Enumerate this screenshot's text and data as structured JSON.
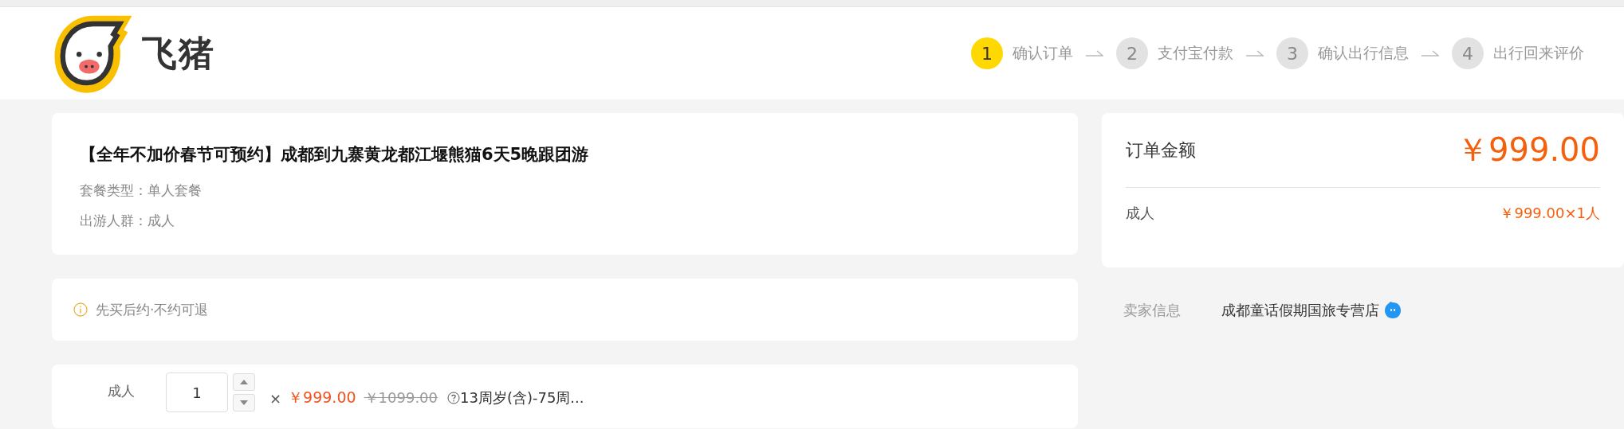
{
  "header": {
    "logo_text": "飞猪",
    "steps": [
      {
        "number": "1",
        "label": "确认订单",
        "selected": true
      },
      {
        "number": "2",
        "label": "支付宝付款",
        "selected": false
      },
      {
        "number": "3",
        "label": "确认出行信息",
        "selected": false
      },
      {
        "number": "4",
        "label": "出行回来评价",
        "selected": false
      }
    ]
  },
  "product": {
    "title": "【全年不加价春节可预约】成都到九寨黄龙都江堰熊猫6天5晚跟团游",
    "details": [
      "套餐类型：单人套餐",
      "出游人群：成人"
    ]
  },
  "notice": {
    "text": "先买后约·不约可退"
  },
  "travelers": [
    {
      "label": "成人",
      "quantity": "1",
      "times": "×",
      "price": "￥999.00",
      "original_price": "￥1099.00",
      "age_range": "13周岁(含)-75周..."
    }
  ],
  "summary": {
    "title": "订单金额",
    "total": "￥999.00",
    "lines": [
      {
        "label": "成人",
        "value": "￥999.00×1人"
      }
    ]
  },
  "seller": {
    "label": "卖家信息",
    "name": "成都童话假期国旅专营店"
  }
}
